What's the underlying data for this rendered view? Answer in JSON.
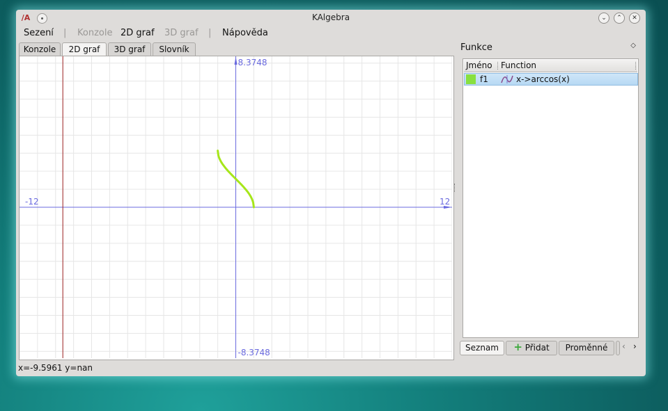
{
  "window": {
    "title": "KAlgebra"
  },
  "menu": [
    "Sezení",
    "Konzole",
    "2D graf",
    "3D graf",
    "Nápověda"
  ],
  "tabs": [
    "Konzole",
    "2D graf",
    "3D graf",
    "Slovník"
  ],
  "plot": {
    "x_range": [
      -12,
      12
    ],
    "y_range": [
      -8.3748,
      8.3748
    ],
    "x_min_label": "-12",
    "x_max_label": "12",
    "y_max_label": "8.3748",
    "y_min_label": "-8.3748",
    "cursor_x": -9.5961,
    "colors": {
      "grid": "#e6e6e6",
      "axis": "#6a6adf",
      "cursor": "#9b2020",
      "curve": "#a6e61a"
    }
  },
  "status": {
    "text": "x=-9.5961 y=nan"
  },
  "dock": {
    "title": "Funkce",
    "columns": [
      "Jméno",
      "Function"
    ],
    "functions": [
      {
        "name": "f1",
        "expression": "x->arccos(x)",
        "color": "#88e040"
      }
    ],
    "tabs": [
      "Seznam",
      "Přidat",
      "Proměnné"
    ]
  }
}
